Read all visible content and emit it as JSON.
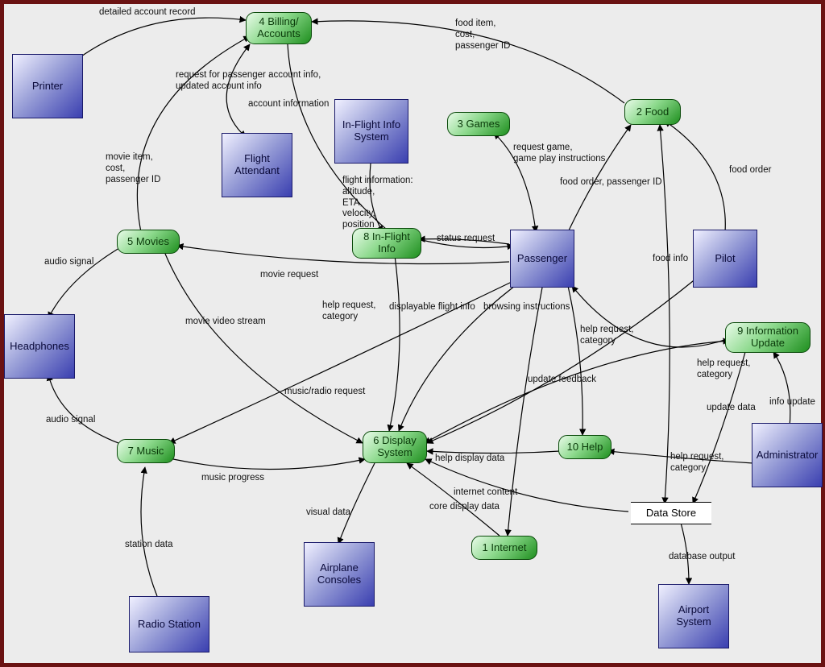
{
  "processes": {
    "billing": {
      "label": "4 Billing/\nAccounts"
    },
    "food": {
      "label": "2 Food"
    },
    "games": {
      "label": "3 Games"
    },
    "movies": {
      "label": "5 Movies"
    },
    "inflight": {
      "label": "8 In-Flight\nInfo"
    },
    "display": {
      "label": "6 Display\nSystem"
    },
    "music": {
      "label": "7 Music"
    },
    "help": {
      "label": "10 Help"
    },
    "internet": {
      "label": "1 Internet"
    },
    "infoupd": {
      "label": "9 Information\nUpdate"
    }
  },
  "externals": {
    "printer": {
      "label": "Printer"
    },
    "attendant": {
      "label": "Flight\nAttendant"
    },
    "infosys": {
      "label": "In-Flight Info\nSystem"
    },
    "passenger": {
      "label": "Passenger"
    },
    "pilot": {
      "label": "Pilot"
    },
    "headphones": {
      "label": "Headphones"
    },
    "admin": {
      "label": "Administrator"
    },
    "consoles": {
      "label": "Airplane\nConsoles"
    },
    "airport": {
      "label": "Airport\nSystem"
    },
    "radio": {
      "label": "Radio Station"
    }
  },
  "stores": {
    "datastore": {
      "label": "Data Store"
    }
  },
  "edges": {
    "e1": "detailed account record",
    "e2": "food item,\ncost,\npassenger ID",
    "e3": "request for passenger account info,\nupdated account info",
    "e4": "account information",
    "e5": "movie item,\ncost,\npassenger ID",
    "e6": "request game,\ngame play instructions",
    "e7": "food order, passenger ID",
    "e8": "food order",
    "e9": "flight information:\naltitude,\nETA,\nvelocity,\nposition",
    "e10": "status request",
    "e11": "audio signal",
    "e12": "movie request",
    "e13": "food info",
    "e14": "movie video stream",
    "e15": "help request,\ncategory",
    "e16": "displayable flight info",
    "e17": "browsing instructions",
    "e18": "help request,\ncategory",
    "e19": "help request,\ncategory",
    "e20": "music/radio request",
    "e21": "update feedback",
    "e22": "update data",
    "e23": "info update",
    "e24": "audio signal",
    "e25": "help display data",
    "e26": "help request,\ncategory",
    "e27": "music progress",
    "e28": "internet content",
    "e29": "core display data",
    "e30": "visual data",
    "e31": "database output",
    "e32": "station data"
  }
}
